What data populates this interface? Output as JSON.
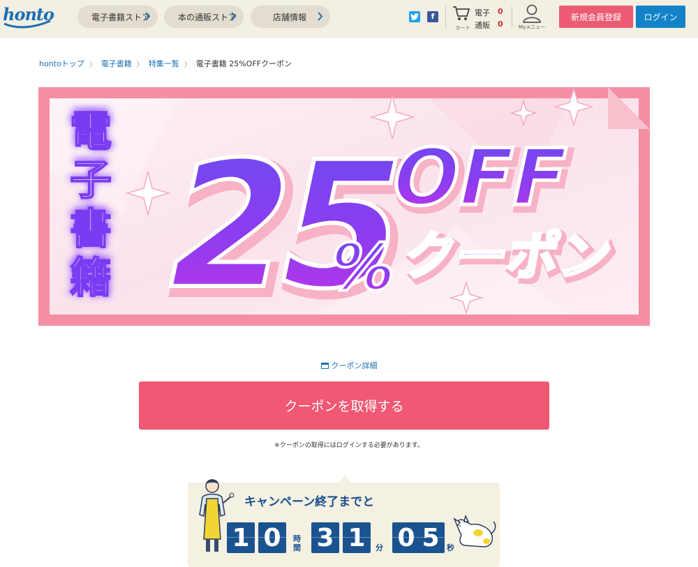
{
  "header": {
    "logo_text": "honto",
    "nav": [
      {
        "label": "電子書籍ストア"
      },
      {
        "label": "本の通販ストア"
      },
      {
        "label": "店舗情報"
      }
    ],
    "social": {
      "twitter": "t",
      "facebook": "f"
    },
    "cart_caption": "カート",
    "counts": [
      {
        "label": "電子",
        "value": "0"
      },
      {
        "label": "通販",
        "value": "0"
      }
    ],
    "mymenu_caption": "Myメニュー",
    "register_label": "新規会員登録",
    "login_label": "ログイン"
  },
  "breadcrumb": {
    "items": [
      "hontoトップ",
      "電子書籍",
      "特集一覧"
    ],
    "separator": "〉",
    "current": "電子書籍 25%OFFクーポン"
  },
  "banner": {
    "vertical_text": "電子書籍",
    "big_number": "25",
    "percent": "%",
    "off": "OFF",
    "coupon": "クーポン"
  },
  "coupon": {
    "detail_link": "クーポン詳細",
    "get_button": "クーポンを取得する",
    "note": "※クーポンの取得にはログインする必要があります。"
  },
  "countdown": {
    "title": "キャンペーン終了までと",
    "hours": [
      "1",
      "0"
    ],
    "minutes": [
      "3",
      "1"
    ],
    "seconds": [
      "0",
      "5"
    ],
    "unit_hours_1": "時",
    "unit_hours_2": "間",
    "unit_minutes": "分",
    "unit_seconds": "秒"
  },
  "colors": {
    "brand_blue": "#1b6fb3",
    "register_pink": "#ec5b73",
    "login_blue": "#1283c9",
    "coupon_button": "#f05873",
    "count_red": "#d9283a",
    "digit_bg": "#1a5390"
  }
}
